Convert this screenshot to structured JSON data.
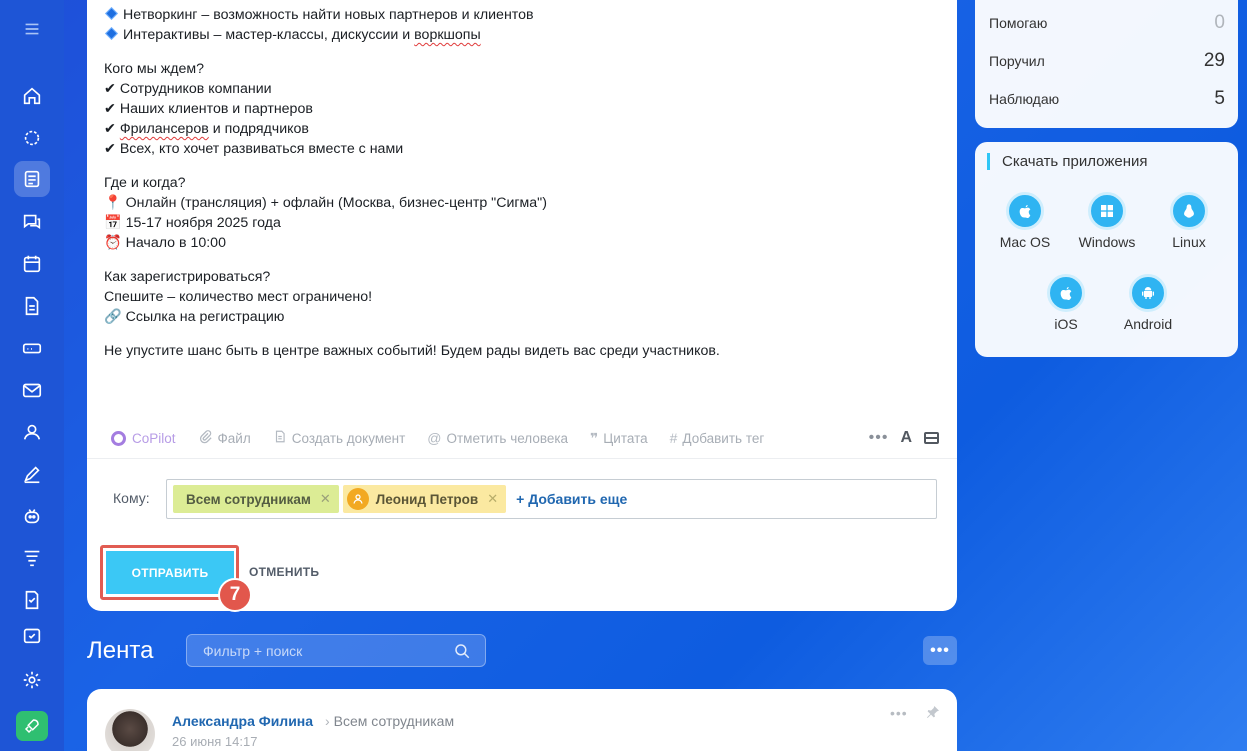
{
  "post": {
    "lines": [
      "Нетворкинг – возможность найти новых партнеров и клиентов",
      "Интерактивы – мастер-классы, дискуссии и воркшопы",
      "Кого мы ждем?",
      "✔ Сотрудников компании",
      "✔ Наших клиентов и партнеров",
      "✔ Фрилансеров и подрядчиков",
      "✔ Всех, кто хочет развиваться вместе с нами",
      "Где и когда?",
      "📍 Онлайн (трансляция) + офлайн (Москва, бизнес-центр \"Сигма\")",
      "📅 15-17 ноября 2025 года",
      "⏰ Начало в 10:00",
      "Как зарегистрироваться?",
      "Спешите – количество мест ограничено!",
      "🔗 Ссылка на регистрацию",
      "Не упустите шанс быть в центре важных событий! Будем рады видеть вас среди участников."
    ],
    "misspelled": [
      "воркшопы",
      "Фрилансеров"
    ]
  },
  "toolbar": {
    "copilot": "CoPilot",
    "file": "Файл",
    "create_doc": "Создать документ",
    "mention": "Отметить человека",
    "quote": "Цитата",
    "add_tag": "Добавить тег",
    "more": "•••",
    "font": "A"
  },
  "recipients": {
    "label": "Кому:",
    "chips": [
      "Всем сотрудникам",
      "Леонид Петров"
    ],
    "add_more": "+ Добавить еще"
  },
  "actions": {
    "send": "ОТПРАВИТЬ",
    "cancel": "ОТМЕНИТЬ",
    "step": "7"
  },
  "feed": {
    "title": "Лента",
    "search_placeholder": "Фильтр + поиск",
    "more": "•••"
  },
  "feed_post": {
    "author": "Александра Филина",
    "target": "Всем сотрудникам",
    "date": "26 июня 14:17"
  },
  "stats": [
    {
      "label": "Помогаю",
      "value": "0"
    },
    {
      "label": "Поручил",
      "value": "29"
    },
    {
      "label": "Наблюдаю",
      "value": "5"
    }
  ],
  "apps": {
    "title": "Скачать приложения",
    "items": [
      "Mac OS",
      "Windows",
      "Linux",
      "iOS",
      "Android"
    ]
  },
  "colors": {
    "accent": "#3bc8f5",
    "link": "#2067b0",
    "sidebar": "#1e55d6",
    "highlight": "#e15c52"
  }
}
